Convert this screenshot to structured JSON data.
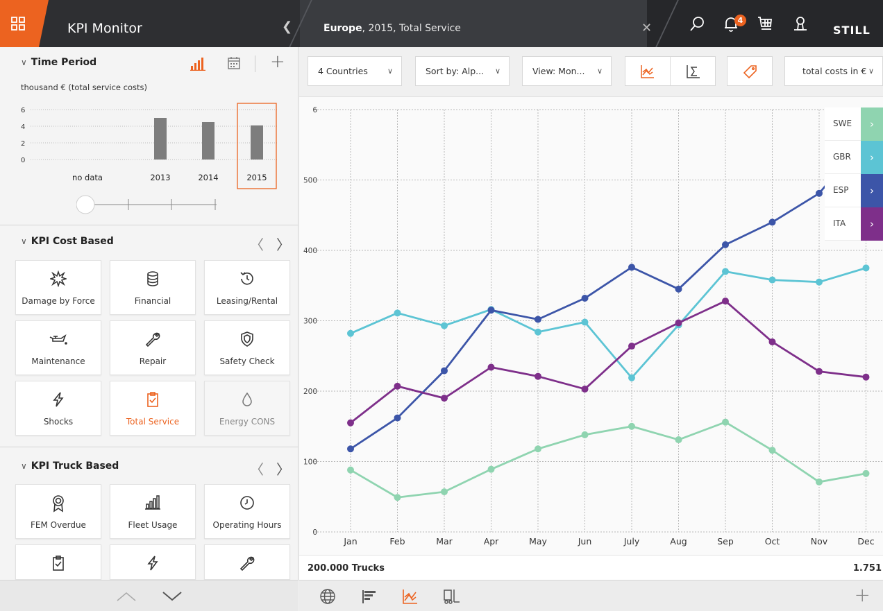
{
  "app": {
    "title": "KPI Monitor",
    "notifications": "4",
    "brand": "STILL"
  },
  "breadcrumb": {
    "region": "Europe",
    "rest": ", 2015, Total Service"
  },
  "colors": {
    "accent": "#ec6320",
    "swe": "#8fd4b0",
    "gbr": "#5cc4d4",
    "esp": "#3c55a8",
    "ita": "#7e2f8a"
  },
  "time_period": {
    "title": "Time Period",
    "subtitle": "thousand € (total service costs)",
    "chart_data": {
      "type": "bar",
      "categories": [
        "no data",
        "2013",
        "2014",
        "2015"
      ],
      "values": [
        null,
        5,
        4.5,
        4.1
      ],
      "yticks": [
        "6",
        "4",
        "2",
        "0"
      ],
      "ylim": [
        0,
        6
      ],
      "selected": "2015"
    }
  },
  "kpi_cost": {
    "title": "KPI Cost Based",
    "tiles": [
      {
        "label": "Damage by Force",
        "icon": "explosion-icon"
      },
      {
        "label": "Financial",
        "icon": "database-icon"
      },
      {
        "label": "Leasing/Rental",
        "icon": "history-icon"
      },
      {
        "label": "Maintenance",
        "icon": "oil-can-icon"
      },
      {
        "label": "Repair",
        "icon": "wrench-icon"
      },
      {
        "label": "Safety Check",
        "icon": "shield-icon"
      },
      {
        "label": "Shocks",
        "icon": "lightning-icon"
      },
      {
        "label": "Total Service",
        "icon": "clipboard-check-icon"
      },
      {
        "label": "Energy CONS",
        "icon": "drop-icon"
      }
    ]
  },
  "kpi_truck": {
    "title": "KPI Truck Based",
    "tiles": [
      {
        "label": "FEM Overdue",
        "icon": "award-icon"
      },
      {
        "label": "Fleet Usage",
        "icon": "bar-chart-icon"
      },
      {
        "label": "Operating Hours",
        "icon": "clock-icon"
      }
    ]
  },
  "toolbar": {
    "countries": "4 Countries",
    "sort": "Sort by: Alp...",
    "view": "View: Mon...",
    "metric": "total costs in €"
  },
  "chart_data": {
    "type": "line",
    "categories": [
      "Jan",
      "Feb",
      "Mar",
      "Apr",
      "May",
      "Jun",
      "July",
      "Aug",
      "Sep",
      "Oct",
      "Nov",
      "Dec"
    ],
    "ylim": [
      0,
      600
    ],
    "yticks": [
      "0",
      "100",
      "200",
      "300",
      "400",
      "500",
      "6"
    ],
    "grid": true,
    "legend_position": "top-right",
    "series": [
      {
        "name": "SWE",
        "color": "#8fd4b0",
        "values": [
          88,
          49,
          57,
          89,
          118,
          138,
          150,
          131,
          156,
          116,
          71,
          83
        ]
      },
      {
        "name": "GBR",
        "color": "#5cc4d4",
        "values": [
          282,
          311,
          293,
          316,
          284,
          298,
          219,
          294,
          370,
          358,
          355,
          375
        ]
      },
      {
        "name": "ESP",
        "color": "#3c55a8",
        "values": [
          118,
          162,
          229,
          315,
          302,
          332,
          376,
          345,
          408,
          440,
          481,
          560
        ]
      },
      {
        "name": "ITA",
        "color": "#7e2f8a",
        "values": [
          155,
          207,
          190,
          234,
          221,
          203,
          264,
          297,
          328,
          270,
          228,
          220
        ]
      }
    ]
  },
  "footer": {
    "left": "200.000 Trucks",
    "right": "1.751"
  }
}
